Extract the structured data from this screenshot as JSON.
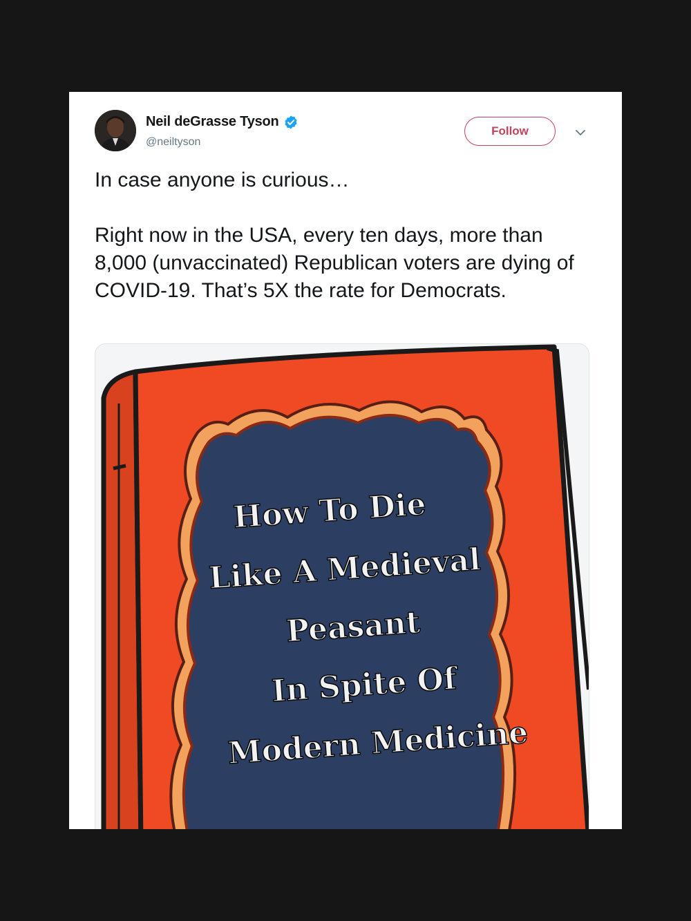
{
  "tweet": {
    "author": {
      "display_name": "Neil deGrasse Tyson",
      "handle": "@neiltyson",
      "verified": true,
      "verified_icon": "verified-badge-icon"
    },
    "follow_label": "Follow",
    "menu_icon": "chevron-down-icon",
    "paragraphs": [
      "In case anyone is curious…",
      "Right now in the USA, every ten days, more than 8,000 (unvaccinated) Republican voters are dying of COVID-19. That’s 5X the rate for Democrats."
    ],
    "media": {
      "title_lines": [
        "How To Die",
        "Like A Medieval",
        "Peasant",
        "In Spite Of",
        "Modern Medicine"
      ]
    }
  },
  "colors": {
    "page_background": "#161616",
    "card_background": "#ffffff",
    "accent": "#c2425c",
    "verified": "#1da1f2",
    "book_cover": "#ef4a24",
    "book_panel": "#2c3f63"
  }
}
